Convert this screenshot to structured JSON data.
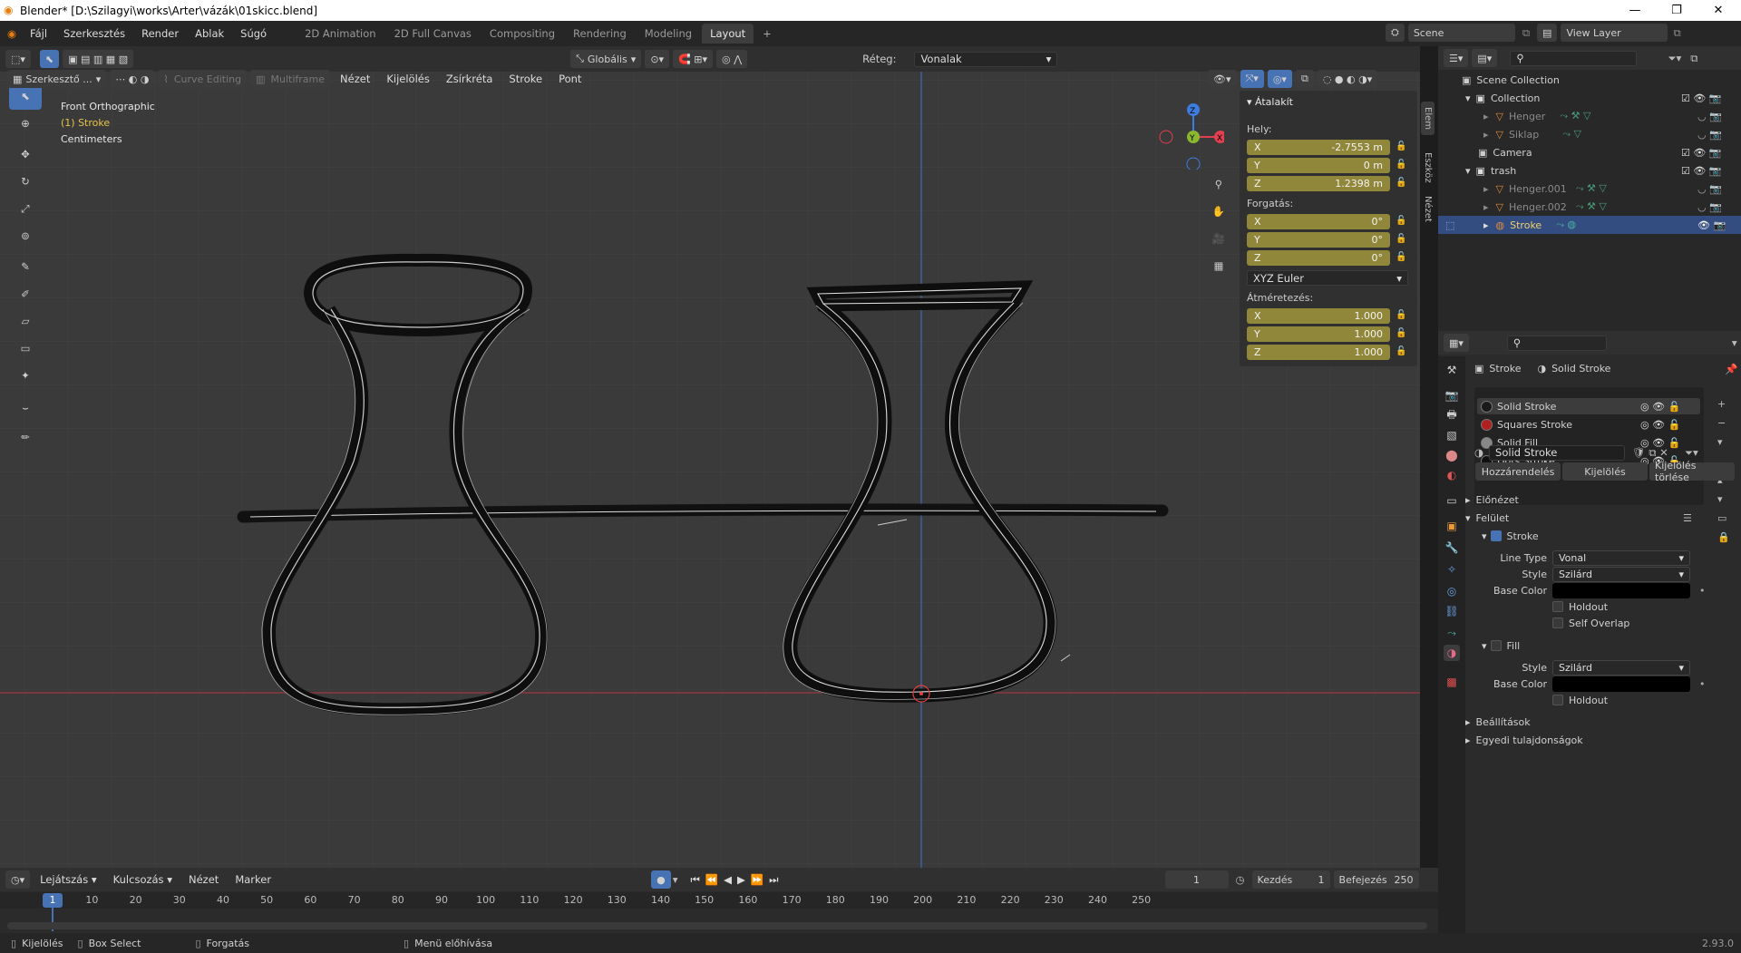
{
  "window": {
    "title": "Blender* [D:\\Szilagyi\\works\\Arter\\vázák\\01skicc.blend]"
  },
  "menu": [
    "Fájl",
    "Szerkesztés",
    "Render",
    "Ablak",
    "Súgó"
  ],
  "workspaces": [
    "2D Animation",
    "2D Full Canvas",
    "Compositing",
    "Rendering",
    "Modeling",
    "Layout"
  ],
  "active_workspace": "Layout",
  "scene": "Scene",
  "view_layer": "View Layer",
  "toolbar": {
    "orientation": "Globális",
    "layer_label": "Réteg:",
    "layer_value": "Vonalak"
  },
  "viewport_header": {
    "mode": "Szerkesztő ...",
    "curve_editing": "Curve Editing",
    "multiframe": "Multiframe",
    "menus": [
      "Nézet",
      "Kijelölés",
      "Zsírkréta",
      "Stroke",
      "Pont"
    ]
  },
  "viewport_info": {
    "view": "Front Orthographic",
    "object": "(1) Stroke",
    "units": "Centimeters"
  },
  "npanel": {
    "title": "Átalakít",
    "location_label": "Hely:",
    "location": [
      {
        "axis": "X",
        "value": "-2.7553 m"
      },
      {
        "axis": "Y",
        "value": "0 m"
      },
      {
        "axis": "Z",
        "value": "1.2398 m"
      }
    ],
    "rotation_label": "Forgatás:",
    "rotation": [
      {
        "axis": "X",
        "value": "0°"
      },
      {
        "axis": "Y",
        "value": "0°"
      },
      {
        "axis": "Z",
        "value": "0°"
      }
    ],
    "rotation_mode": "XYZ Euler",
    "scale_label": "Átméretezés:",
    "scale": [
      {
        "axis": "X",
        "value": "1.000"
      },
      {
        "axis": "Y",
        "value": "1.000"
      },
      {
        "axis": "Z",
        "value": "1.000"
      }
    ],
    "tabs": [
      "Elem",
      "Eszköz",
      "Nézet"
    ]
  },
  "outliner": {
    "rows": [
      {
        "label": "Scene Collection",
        "indent": 0
      },
      {
        "label": "Collection",
        "indent": 1
      },
      {
        "label": "Henger",
        "indent": 2
      },
      {
        "label": "Siklap",
        "indent": 2
      },
      {
        "label": "Camera",
        "indent": 1
      },
      {
        "label": "trash",
        "indent": 1
      },
      {
        "label": "Henger.001",
        "indent": 2
      },
      {
        "label": "Henger.002",
        "indent": 2
      },
      {
        "label": "Stroke",
        "indent": 2
      }
    ]
  },
  "properties": {
    "object_name": "Stroke",
    "material_name": "Solid Stroke",
    "materials": [
      "Solid Stroke",
      "Squares Stroke",
      "Solid Fill",
      "Dots Stroke"
    ],
    "material_colors": [
      "#1a1a1a",
      "#b02020",
      "#888888",
      "#111111"
    ],
    "slot_field": "Solid Stroke",
    "assign_buttons": [
      "Hozzárendelés",
      "Kijelölés",
      "Kijelölés törlése"
    ],
    "sections": {
      "preview": "Előnézet",
      "surface": "Felület",
      "stroke": "Stroke",
      "line_type_label": "Line Type",
      "line_type": "Vonal",
      "style_label": "Style",
      "style": "Szilárd",
      "base_color_label": "Base Color",
      "holdout": "Holdout",
      "self_overlap": "Self Overlap",
      "fill": "Fill",
      "fill_style": "Szilárd",
      "settings": "Beállítások",
      "custom_props": "Egyedi tulajdonságok"
    }
  },
  "timeline": {
    "menus": [
      "Lejátszás",
      "Kulcsozás",
      "Nézet",
      "Marker"
    ],
    "current_frame": "1",
    "start_label": "Kezdés",
    "start": "1",
    "end_label": "Befejezés",
    "end": "250",
    "ticks": [
      "1",
      "10",
      "20",
      "30",
      "40",
      "50",
      "60",
      "70",
      "80",
      "90",
      "100",
      "110",
      "120",
      "130",
      "140",
      "150",
      "160",
      "170",
      "180",
      "190",
      "200",
      "210",
      "220",
      "230",
      "240",
      "250"
    ]
  },
  "status": {
    "select": "Kijelölés",
    "box_select": "Box Select",
    "rotate": "Forgatás",
    "menu": "Menü előhívása",
    "version": "2.93.0"
  }
}
